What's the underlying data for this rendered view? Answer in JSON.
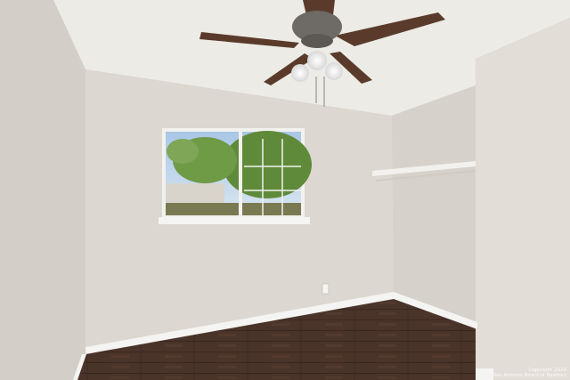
{
  "photo": {
    "subject": "empty bedroom",
    "colors": {
      "ceiling": "#ecebe6",
      "back_wall": "#dcd7d0",
      "left_wall": "#d3cec7",
      "right_wall": "#e2ddd6",
      "closet_wall": "#d6d1ca",
      "floor": "#4a342a",
      "floor_dark": "#3a2820",
      "baseboard": "#f4f4f2",
      "window_frame": "#f2f1ee",
      "sky": "#a9c6e6",
      "foliage": "#5f8a3a",
      "fan_blade": "#5a3b2b",
      "fan_metal": "#6e6a66"
    }
  },
  "watermark": {
    "line1": "Copyright 2024",
    "line2": "San Antonio Board of Realtors"
  }
}
